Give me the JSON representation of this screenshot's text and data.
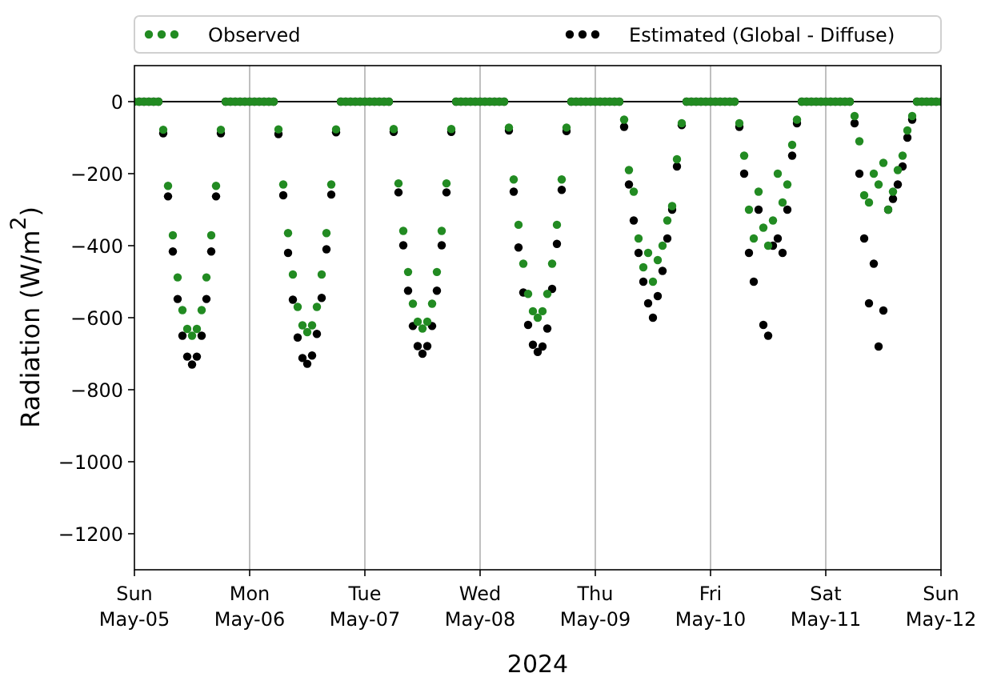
{
  "chart": {
    "chart_data": {
      "type": "scatter",
      "legend": true,
      "xlabel": "2024",
      "ylabel": "Radiation (W/m$^{2}$)",
      "ylim": [
        -1300,
        100
      ],
      "categories": [
        "Sun\nMay-05",
        null,
        null,
        null,
        null,
        null,
        null,
        null,
        null,
        null,
        null,
        null,
        null,
        null,
        null,
        null,
        null,
        null,
        null,
        null,
        null,
        null,
        null,
        null,
        "Mon\nMay-06",
        null,
        null,
        null,
        null,
        null,
        null,
        null,
        null,
        null,
        null,
        null,
        null,
        null,
        null,
        null,
        null,
        null,
        null,
        null,
        null,
        null,
        null,
        null,
        "Tue\nMay-07",
        null,
        null,
        null,
        null,
        null,
        null,
        null,
        null,
        null,
        null,
        null,
        null,
        null,
        null,
        null,
        null,
        null,
        null,
        null,
        null,
        null,
        null,
        null,
        "Wed\nMay-08",
        null,
        null,
        null,
        null,
        null,
        null,
        null,
        null,
        null,
        null,
        null,
        null,
        null,
        null,
        null,
        null,
        null,
        null,
        null,
        null,
        null,
        null,
        null,
        "Thu\nMay-09",
        null,
        null,
        null,
        null,
        null,
        null,
        null,
        null,
        null,
        null,
        null,
        null,
        null,
        null,
        null,
        null,
        null,
        null,
        null,
        null,
        null,
        null,
        null,
        "Fri\nMay-10",
        null,
        null,
        null,
        null,
        null,
        null,
        null,
        null,
        null,
        null,
        null,
        null,
        null,
        null,
        null,
        null,
        null,
        null,
        null,
        null,
        null,
        null,
        null,
        "Sat\nMay-11",
        null,
        null,
        null,
        null,
        null,
        null,
        null,
        null,
        null,
        null,
        null,
        null,
        null,
        null,
        null,
        null,
        null,
        null,
        null,
        null,
        null,
        null,
        null,
        "Sun\nMay-12"
      ],
      "yticks": [
        {
          "value": -1200,
          "label": "−1200"
        },
        {
          "value": -1000,
          "label": "−1000"
        },
        {
          "value": -800,
          "label": "−800"
        },
        {
          "value": -600,
          "label": "−600"
        },
        {
          "value": -400,
          "label": "−400"
        },
        {
          "value": -200,
          "label": "−200"
        },
        {
          "value": 0,
          "label": "0"
        }
      ],
      "series": [
        {
          "name": "Observed",
          "color": "#228b22",
          "values": [
            0,
            0,
            0,
            0,
            0,
            0,
            -78,
            -234,
            -371,
            -488,
            -579,
            -631,
            -650,
            -631,
            -579,
            -488,
            -371,
            -234,
            -78,
            0,
            0,
            0,
            0,
            0,
            0,
            0,
            0,
            0,
            0,
            0,
            -77,
            -230,
            -365,
            -480,
            -570,
            -621,
            -640,
            -621,
            -570,
            -480,
            -365,
            -230,
            -77,
            0,
            0,
            0,
            0,
            0,
            0,
            0,
            0,
            0,
            0,
            0,
            -76,
            -227,
            -359,
            -473,
            -561,
            -611,
            -630,
            -611,
            -561,
            -473,
            -359,
            -227,
            -76,
            0,
            0,
            0,
            0,
            0,
            0,
            0,
            0,
            0,
            0,
            0,
            -72,
            -216,
            -342,
            -450,
            -534,
            -582,
            -600,
            -582,
            -534,
            -450,
            -342,
            -216,
            -72,
            0,
            0,
            0,
            0,
            0,
            0,
            0,
            0,
            0,
            0,
            0,
            -50,
            -190,
            -250,
            -380,
            -460,
            -420,
            -500,
            -440,
            -400,
            -330,
            -290,
            -160,
            -60,
            0,
            0,
            0,
            0,
            0,
            0,
            0,
            0,
            0,
            0,
            0,
            -60,
            -150,
            -300,
            -380,
            -250,
            -350,
            -400,
            -330,
            -200,
            -280,
            -230,
            -120,
            -50,
            0,
            0,
            0,
            0,
            0,
            0,
            0,
            0,
            0,
            0,
            0,
            -40,
            -110,
            -260,
            -280,
            -200,
            -230,
            -170,
            -300,
            -250,
            -190,
            -150,
            -80,
            -40,
            0,
            0,
            0,
            0,
            0,
            0
          ]
        },
        {
          "name": "Estimated (Global - Diffuse)",
          "color": "#000000",
          "values": [
            null,
            0,
            0,
            0,
            0,
            0,
            -88,
            -263,
            -416,
            -548,
            -650,
            -708,
            -730,
            -708,
            -650,
            -548,
            -416,
            -263,
            -88,
            0,
            0,
            0,
            0,
            0,
            0,
            0,
            0,
            0,
            0,
            0,
            -90,
            -260,
            -420,
            -550,
            -655,
            -712,
            -728,
            -705,
            -645,
            -545,
            -410,
            -258,
            -85,
            0,
            0,
            0,
            0,
            0,
            0,
            0,
            0,
            0,
            0,
            0,
            -84,
            -252,
            -399,
            -525,
            -623,
            -679,
            -700,
            -679,
            -623,
            -525,
            -399,
            -252,
            -84,
            0,
            0,
            0,
            0,
            0,
            0,
            0,
            0,
            0,
            0,
            0,
            -80,
            -250,
            -405,
            -530,
            -620,
            -675,
            -695,
            -680,
            -630,
            -520,
            -395,
            -245,
            -82,
            0,
            0,
            0,
            0,
            0,
            0,
            0,
            0,
            0,
            0,
            0,
            -70,
            -230,
            -330,
            -420,
            -500,
            -560,
            -600,
            -540,
            -470,
            -380,
            -300,
            -180,
            -65,
            0,
            0,
            0,
            0,
            0,
            0,
            0,
            0,
            0,
            0,
            0,
            -70,
            -200,
            -420,
            -500,
            -300,
            -620,
            -650,
            -400,
            -380,
            -420,
            -300,
            -150,
            -60,
            0,
            0,
            0,
            0,
            0,
            0,
            0,
            0,
            0,
            0,
            0,
            -60,
            -200,
            -380,
            -560,
            -450,
            -680,
            -580,
            -300,
            -270,
            -230,
            -180,
            -100,
            -50,
            0,
            0,
            0,
            0,
            0,
            null
          ]
        }
      ]
    }
  }
}
